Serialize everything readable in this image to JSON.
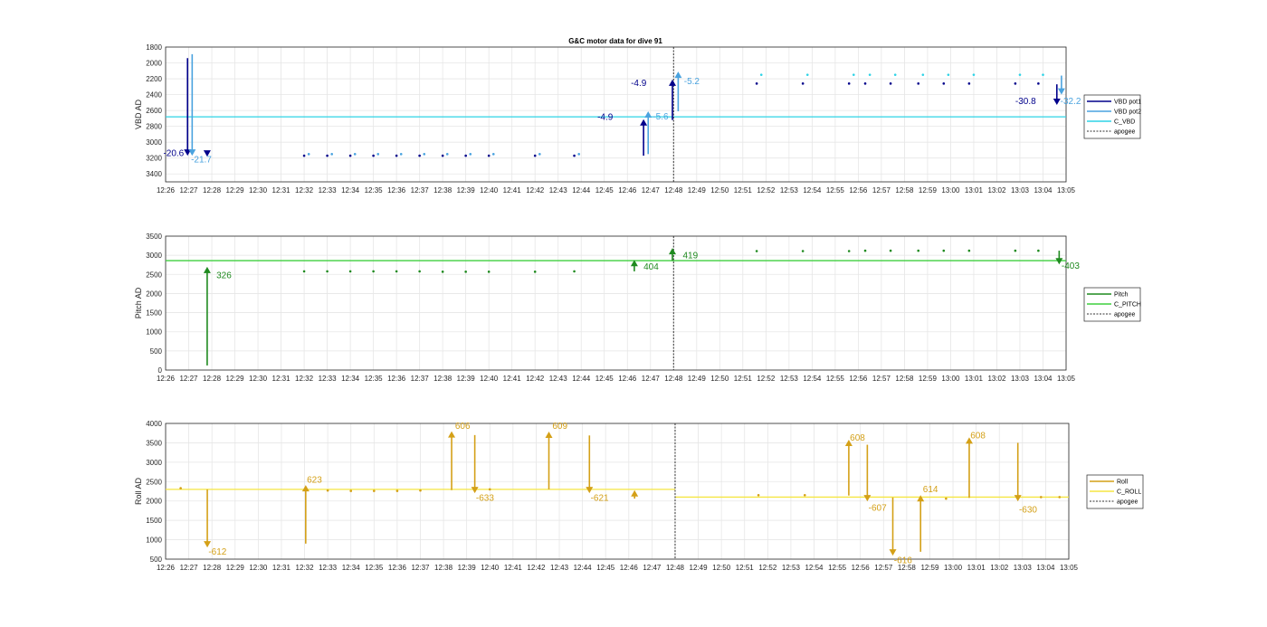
{
  "title": "G&C motor data for dive 91",
  "chart_data": [
    {
      "type": "line",
      "ylabel": "VBD AD",
      "ylim": [
        1800,
        3500
      ],
      "y_reversed": true,
      "yticks": [
        1800,
        2000,
        2200,
        2400,
        2600,
        2800,
        3000,
        3200,
        3400
      ],
      "x_ticks": [
        "12:26",
        "12:27",
        "12:28",
        "12:29",
        "12:30",
        "12:31",
        "12:32",
        "12:33",
        "12:34",
        "12:35",
        "12:36",
        "12:37",
        "12:38",
        "12:39",
        "12:40",
        "12:41",
        "12:42",
        "12:43",
        "12:44",
        "12:45",
        "12:46",
        "12:47",
        "12:48",
        "12:49",
        "12:50",
        "12:51",
        "12:52",
        "12:53",
        "12:54",
        "12:55",
        "12:56",
        "12:57",
        "12:58",
        "12:59",
        "13:00",
        "13:01",
        "13:02",
        "13:03",
        "13:04",
        "13:05"
      ],
      "grid": true,
      "legend": {
        "placement": "right",
        "entries": [
          {
            "name": "VBD pot1",
            "color": "#00008b",
            "style": "solid"
          },
          {
            "name": "VBD pot2",
            "color": "#4aa3df",
            "style": "solid"
          },
          {
            "name": "C_VBD",
            "color": "#2ed3e6",
            "style": "solid"
          },
          {
            "name": "apogee",
            "color": "#333333",
            "style": "dotted"
          }
        ]
      },
      "hlines": [
        {
          "name": "C_VBD",
          "y": 2680,
          "color": "#2ed3e6"
        }
      ],
      "apogee_x": 22.0,
      "arrows": [
        {
          "x": 0.95,
          "y_from": 1940,
          "y_to": 3170,
          "color": "#00008b"
        },
        {
          "x": 1.15,
          "y_from": 1890,
          "y_to": 3170,
          "color": "#4aa3df"
        },
        {
          "x": 20.7,
          "y_from": 3170,
          "y_to": 2710,
          "color": "#00008b"
        },
        {
          "x": 20.9,
          "y_from": 3150,
          "y_to": 2610,
          "color": "#4aa3df"
        },
        {
          "x": 21.95,
          "y_from": 2720,
          "y_to": 2210,
          "color": "#00008b"
        },
        {
          "x": 22.2,
          "y_from": 2610,
          "y_to": 2110,
          "color": "#4aa3df"
        },
        {
          "x": 38.6,
          "y_from": 2270,
          "y_to": 2530,
          "color": "#00008b"
        },
        {
          "x": 38.8,
          "y_from": 2160,
          "y_to": 2400,
          "color": "#4aa3df"
        }
      ],
      "markers": [
        {
          "x": 1.8,
          "y": 3170,
          "color": "#00008b",
          "shape": "tri-down"
        }
      ],
      "points": [
        {
          "color": "#00008b",
          "x": [
            6.0,
            7.0,
            8.0,
            9.0,
            10.0,
            11.0,
            12.0,
            13.0,
            14.0,
            16.0,
            17.7
          ],
          "y": [
            3170,
            3170,
            3170,
            3170,
            3170,
            3170,
            3170,
            3170,
            3170,
            3170,
            3170
          ]
        },
        {
          "color": "#4aa3df",
          "x": [
            6.2,
            7.2,
            8.2,
            9.2,
            10.2,
            11.2,
            12.2,
            13.2,
            14.2,
            16.2,
            17.9
          ],
          "y": [
            3150,
            3150,
            3150,
            3150,
            3150,
            3150,
            3150,
            3150,
            3150,
            3150,
            3150
          ]
        },
        {
          "color": "#00008b",
          "x": [
            25.6,
            27.6,
            29.6,
            30.3,
            31.4,
            32.6,
            33.7,
            34.8,
            36.8,
            37.8
          ],
          "y": [
            2260,
            2260,
            2260,
            2260,
            2260,
            2260,
            2260,
            2260,
            2260,
            2260
          ]
        },
        {
          "color": "#2ed3e6",
          "x": [
            25.8,
            27.8,
            29.8,
            30.5,
            31.6,
            32.8,
            33.9,
            35.0,
            37.0,
            38.0
          ],
          "y": [
            2150,
            2150,
            2150,
            2150,
            2150,
            2150,
            2150,
            2150,
            2150,
            2150
          ]
        }
      ],
      "annotations": [
        {
          "text": "-20.6",
          "x": -0.1,
          "y": 3175,
          "color": "#00008b"
        },
        {
          "text": "-21.7",
          "x": 1.1,
          "y": 3255,
          "color": "#4aa3df"
        },
        {
          "text": "-4.9",
          "x": 18.7,
          "y": 2720,
          "color": "#00008b"
        },
        {
          "text": "-5.6",
          "x": 21.1,
          "y": 2715,
          "color": "#4aa3df"
        },
        {
          "text": "-4.9",
          "x": 20.15,
          "y": 2290,
          "color": "#00008b"
        },
        {
          "text": "-5.2",
          "x": 22.45,
          "y": 2265,
          "color": "#4aa3df"
        },
        {
          "text": "-30.8",
          "x": 36.8,
          "y": 2520,
          "color": "#00008b"
        },
        {
          "text": "-32.2",
          "x": 38.75,
          "y": 2520,
          "color": "#4aa3df"
        }
      ]
    },
    {
      "type": "line",
      "ylabel": "Pitch AD",
      "ylim": [
        0,
        3500
      ],
      "yticks": [
        0,
        500,
        1000,
        1500,
        2000,
        2500,
        3000,
        3500
      ],
      "x_ticks": [
        "12:26",
        "12:27",
        "12:28",
        "12:29",
        "12:30",
        "12:31",
        "12:32",
        "12:33",
        "12:34",
        "12:35",
        "12:36",
        "12:37",
        "12:38",
        "12:39",
        "12:40",
        "12:41",
        "12:42",
        "12:43",
        "12:44",
        "12:45",
        "12:46",
        "12:47",
        "12:48",
        "12:49",
        "12:50",
        "12:51",
        "12:52",
        "12:53",
        "12:54",
        "12:55",
        "12:56",
        "12:57",
        "12:58",
        "12:59",
        "13:00",
        "13:01",
        "13:02",
        "13:03",
        "13:04",
        "13:05"
      ],
      "grid": true,
      "legend": {
        "placement": "right",
        "entries": [
          {
            "name": "Pitch",
            "color": "#1f8a1f",
            "style": "solid"
          },
          {
            "name": "C_PITCH",
            "color": "#3ecf3e",
            "style": "solid"
          },
          {
            "name": "apogee",
            "color": "#333333",
            "style": "dotted"
          }
        ]
      },
      "hlines": [
        {
          "name": "C_PITCH",
          "y": 2860,
          "color": "#3ecf3e"
        }
      ],
      "apogee_x": 22.0,
      "arrows": [
        {
          "x": 1.8,
          "y_from": 120,
          "y_to": 2700,
          "color": "#1f8a1f"
        },
        {
          "x": 20.3,
          "y_from": 2580,
          "y_to": 2880,
          "color": "#1f8a1f"
        },
        {
          "x": 21.95,
          "y_from": 2860,
          "y_to": 3190,
          "color": "#1f8a1f"
        },
        {
          "x": 38.7,
          "y_from": 3120,
          "y_to": 2760,
          "color": "#1f8a1f"
        }
      ],
      "points": [
        {
          "color": "#1f8a1f",
          "x": [
            6.0,
            7.0,
            8.0,
            9.0,
            10.0,
            11.0,
            12.0,
            13.0,
            14.0,
            16.0,
            17.7,
            25.6,
            27.6,
            29.6,
            30.3,
            31.4,
            32.6,
            33.7,
            34.8,
            36.8,
            37.8
          ],
          "y": [
            2580,
            2580,
            2580,
            2580,
            2580,
            2580,
            2570,
            2570,
            2570,
            2570,
            2580,
            3110,
            3110,
            3110,
            3120,
            3120,
            3120,
            3120,
            3120,
            3120,
            3120
          ]
        }
      ],
      "annotations": [
        {
          "text": "326",
          "x": 2.2,
          "y": 2400,
          "color": "#1f8a1f"
        },
        {
          "text": "404",
          "x": 20.7,
          "y": 2620,
          "color": "#1f8a1f"
        },
        {
          "text": "419",
          "x": 22.4,
          "y": 2920,
          "color": "#1f8a1f"
        },
        {
          "text": "-403",
          "x": 38.8,
          "y": 2650,
          "color": "#1f8a1f"
        }
      ]
    },
    {
      "type": "line",
      "ylabel": "Roll AD",
      "ylim": [
        500,
        4000
      ],
      "yticks": [
        500,
        1000,
        1500,
        2000,
        2500,
        3000,
        3500,
        4000
      ],
      "x_ticks": [
        "12:26",
        "12:27",
        "12:28",
        "12:29",
        "12:30",
        "12:31",
        "12:32",
        "12:33",
        "12:34",
        "12:35",
        "12:36",
        "12:37",
        "12:38",
        "12:39",
        "12:40",
        "12:41",
        "12:42",
        "12:43",
        "12:44",
        "12:45",
        "12:46",
        "12:47",
        "12:48",
        "12:49",
        "12:50",
        "12:51",
        "12:52",
        "12:53",
        "12:54",
        "12:55",
        "12:56",
        "12:57",
        "12:58",
        "12:59",
        "13:00",
        "13:01",
        "13:02",
        "13:03",
        "13:04",
        "13:05"
      ],
      "grid": true,
      "legend": {
        "placement": "right",
        "entries": [
          {
            "name": "Roll",
            "color": "#d4a017",
            "style": "solid"
          },
          {
            "name": "C_ROLL",
            "color": "#f5e642",
            "style": "solid"
          },
          {
            "name": "apogee",
            "color": "#333333",
            "style": "dotted"
          }
        ]
      },
      "hlines": [
        {
          "name": "C_ROLL",
          "y": 2300,
          "x_from": 0.0,
          "x_to": 22.0,
          "color": "#f5e642"
        },
        {
          "name": "C_ROLL",
          "y": 2100,
          "x_from": 22.0,
          "x_to": 39.0,
          "color": "#f5e642"
        }
      ],
      "apogee_x": 22.0,
      "arrows": [
        {
          "x": 1.8,
          "y_from": 2300,
          "y_to": 800,
          "color": "#d4a017"
        },
        {
          "x": 6.05,
          "y_from": 900,
          "y_to": 2410,
          "color": "#d4a017"
        },
        {
          "x": 12.35,
          "y_from": 2280,
          "y_to": 3800,
          "color": "#d4a017"
        },
        {
          "x": 13.35,
          "y_from": 3700,
          "y_to": 2200,
          "color": "#d4a017"
        },
        {
          "x": 16.55,
          "y_from": 2300,
          "y_to": 3790,
          "color": "#d4a017"
        },
        {
          "x": 18.3,
          "y_from": 3690,
          "y_to": 2200,
          "color": "#d4a017"
        },
        {
          "x": 20.25,
          "y_from": 2060,
          "y_to": 2280,
          "color": "#d4a017"
        },
        {
          "x": 29.5,
          "y_from": 2140,
          "y_to": 3580,
          "color": "#d4a017"
        },
        {
          "x": 30.3,
          "y_from": 3450,
          "y_to": 1990,
          "color": "#d4a017"
        },
        {
          "x": 31.4,
          "y_from": 2090,
          "y_to": 590,
          "color": "#d4a017"
        },
        {
          "x": 32.6,
          "y_from": 690,
          "y_to": 2150,
          "color": "#d4a017"
        },
        {
          "x": 34.7,
          "y_from": 2080,
          "y_to": 3640,
          "color": "#d4a017"
        },
        {
          "x": 36.8,
          "y_from": 3500,
          "y_to": 1990,
          "color": "#d4a017"
        }
      ],
      "points": [
        {
          "color": "#d4a017",
          "x": [
            0.65,
            7.0,
            8.0,
            9.0,
            10.0,
            11.0,
            14.0,
            25.6,
            27.6,
            33.7,
            37.8,
            38.6
          ],
          "y": [
            2330,
            2270,
            2260,
            2260,
            2260,
            2270,
            2300,
            2150,
            2150,
            2060,
            2100,
            2100
          ]
        }
      ],
      "annotations": [
        {
          "text": "-612",
          "x": 1.85,
          "y": 620,
          "color": "#d4a017"
        },
        {
          "text": "623",
          "x": 6.1,
          "y": 2470,
          "color": "#d4a017"
        },
        {
          "text": "606",
          "x": 12.5,
          "y": 3860,
          "color": "#d4a017"
        },
        {
          "text": "-633",
          "x": 13.4,
          "y": 2010,
          "color": "#d4a017"
        },
        {
          "text": "609",
          "x": 16.7,
          "y": 3860,
          "color": "#d4a017"
        },
        {
          "text": "-621",
          "x": 18.35,
          "y": 2010,
          "color": "#d4a017"
        },
        {
          "text": "608",
          "x": 29.55,
          "y": 3560,
          "color": "#d4a017"
        },
        {
          "text": "-607",
          "x": 30.35,
          "y": 1750,
          "color": "#d4a017"
        },
        {
          "text": "-616",
          "x": 31.45,
          "y": 400,
          "color": "#d4a017"
        },
        {
          "text": "614",
          "x": 32.7,
          "y": 2230,
          "color": "#d4a017"
        },
        {
          "text": "608",
          "x": 34.75,
          "y": 3620,
          "color": "#d4a017"
        },
        {
          "text": "-630",
          "x": 36.85,
          "y": 1700,
          "color": "#d4a017"
        }
      ]
    }
  ]
}
